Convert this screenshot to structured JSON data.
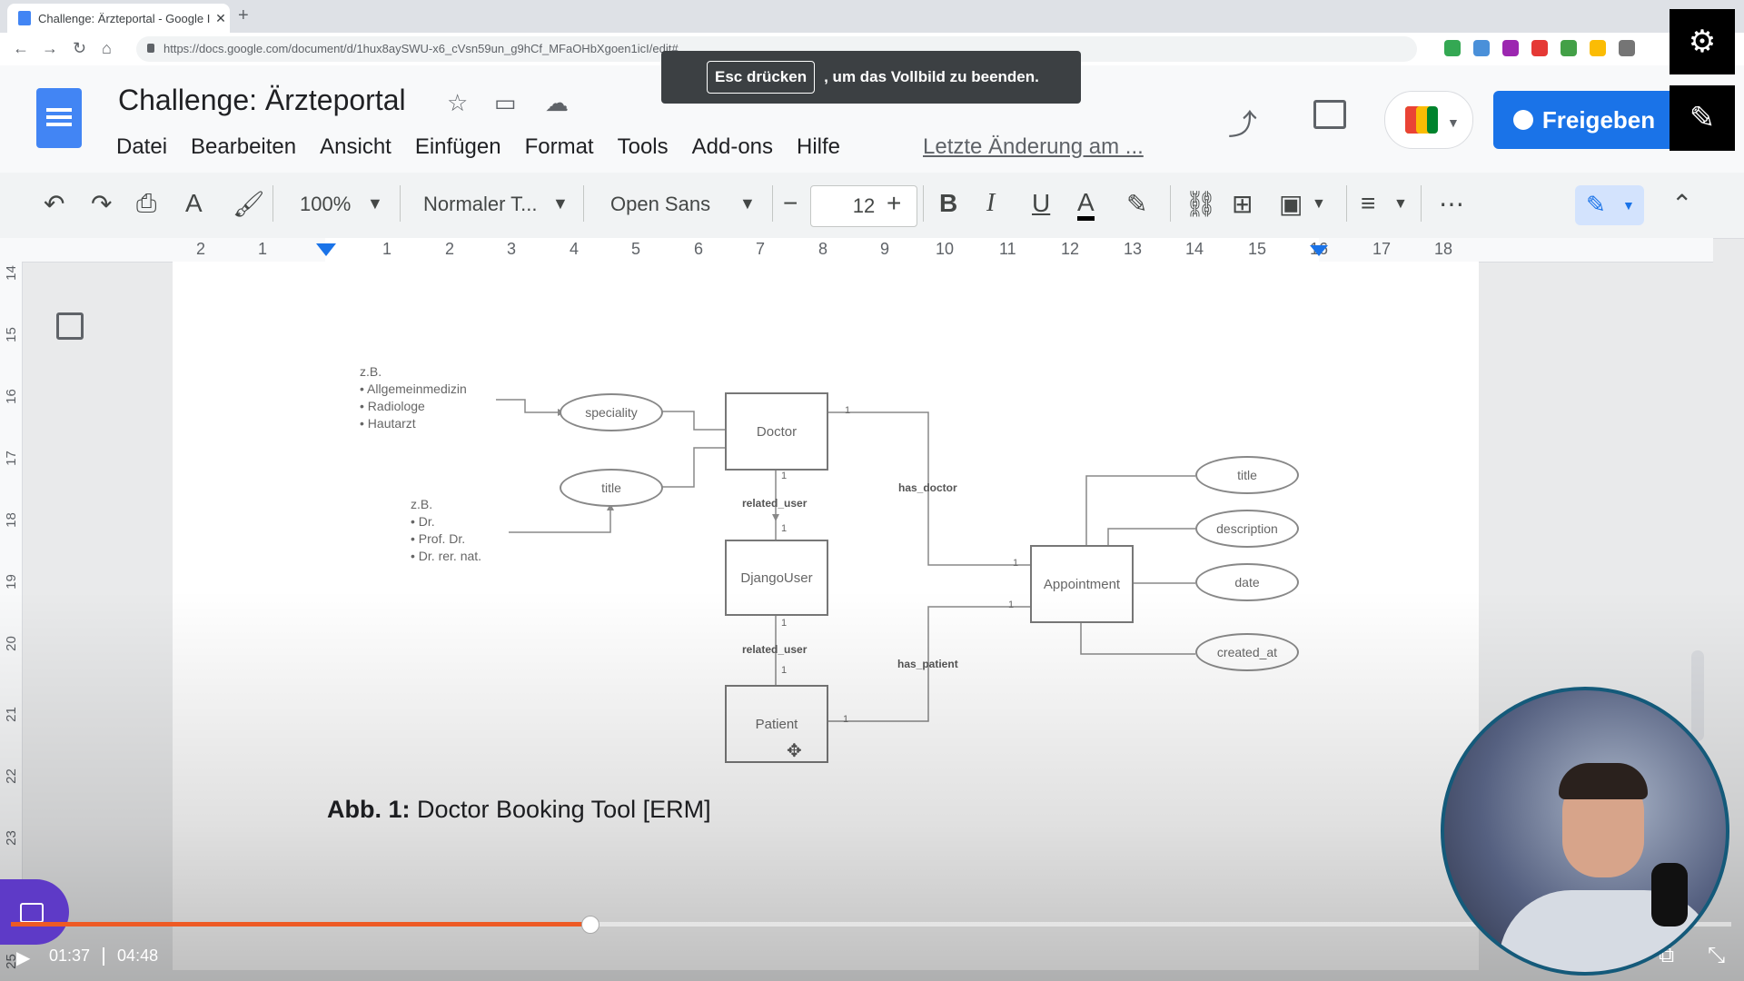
{
  "browser": {
    "tab_title": "Challenge: Ärzteportal - Google I",
    "tab_close": "✕",
    "new_tab": "+",
    "url": "https://docs.google.com/document/d/1hux8aySWU-x6_cVsn59un_g9hCf_MFaOHbXgoen1icI/edit#"
  },
  "docs": {
    "title": "Challenge: Ärzteportal",
    "menu": [
      "Datei",
      "Bearbeiten",
      "Ansicht",
      "Einfügen",
      "Format",
      "Tools",
      "Add-ons",
      "Hilfe"
    ],
    "last_edit": "Letzte Änderung am ...",
    "share_label": "Freigeben"
  },
  "toast": {
    "key": "Esc drücken",
    "text": ", um das Vollbild zu beenden."
  },
  "toolbar": {
    "zoom": "100%",
    "style": "Normaler T...",
    "font": "Open Sans",
    "font_size": "12"
  },
  "ruler": {
    "numbers": [
      "2",
      "1",
      "1",
      "2",
      "3",
      "4",
      "5",
      "6",
      "7",
      "8",
      "9",
      "10",
      "11",
      "12",
      "13",
      "14",
      "15",
      "16",
      "17",
      "18"
    ],
    "vertical": [
      "14",
      "15",
      "16",
      "17",
      "18",
      "19",
      "20",
      "21",
      "22",
      "23",
      "25"
    ]
  },
  "diagram": {
    "entities": {
      "doctor": "Doctor",
      "django_user": "DjangoUser",
      "patient": "Patient",
      "appointment": "Appointment"
    },
    "attributes": {
      "speciality": "speciality",
      "doctor_title": "title",
      "appt_title": "title",
      "description": "description",
      "date": "date",
      "created_at": "created_at"
    },
    "relations": {
      "related_user_1": "related_user",
      "related_user_2": "related_user",
      "has_doctor": "has_doctor",
      "has_patient": "has_patient"
    },
    "cardinality": "1",
    "note_speciality": [
      "z.B.",
      "• Allgemeinmedizin",
      "• Radiologe",
      "• Hautarzt"
    ],
    "note_title": [
      "z.B.",
      "• Dr.",
      "• Prof. Dr.",
      "• Dr. rer. nat."
    ],
    "caption_bold": "Abb. 1:",
    "caption_text": " Doctor Booking Tool [ERM]"
  },
  "video": {
    "current_time": "01:37",
    "total_time": "04:48",
    "progress_fraction": 0.337
  },
  "colors": {
    "progress": "#ee5a24",
    "share": "#1a73e8",
    "docs_blue": "#4285f4"
  }
}
